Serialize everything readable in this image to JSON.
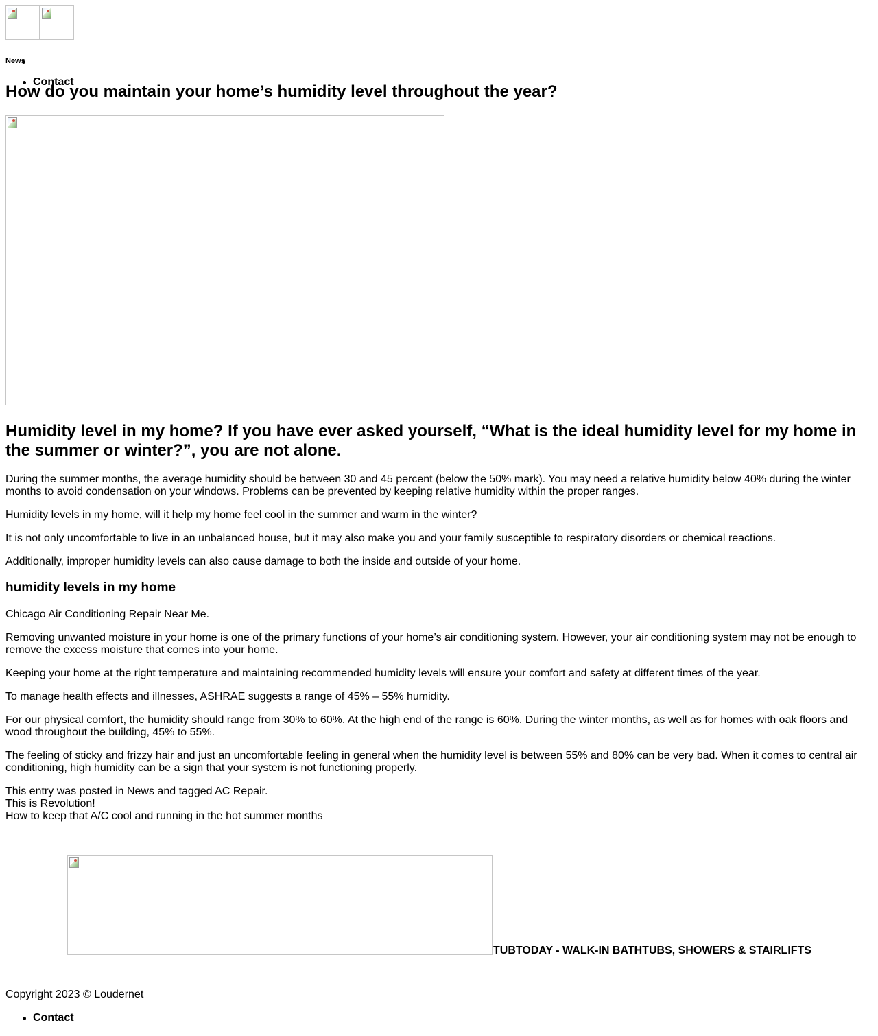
{
  "header": {
    "logo_images": [
      "logo-image-1",
      "logo-image-2"
    ],
    "nav": {
      "news_label": "News",
      "contact_label": "Contact"
    }
  },
  "article": {
    "title": "How do you maintain your home’s humidity level throughout the year?",
    "subtitle": "Humidity level in my home? If you have ever asked yourself, “What is the ideal humidity level for my home in the summer or winter?”, you are not alone.",
    "paragraphs_1": [
      "During the summer months, the average humidity should be between 30 and 45 percent (below the 50% mark). You may need a relative humidity below 40% during the winter months to avoid condensation on your windows. Problems can be prevented by keeping relative humidity within the proper ranges.",
      "Humidity levels in my home, will it help my home feel cool in the summer and warm in the winter?",
      "It is not only uncomfortable to live in an unbalanced house, but it may also make you and your family susceptible to respiratory disorders or chemical reactions.",
      "Additionally, improper humidity levels can also cause damage to both the inside and outside of your home."
    ],
    "section_heading": "humidity levels in my home",
    "paragraphs_2": [
      "Chicago Air Conditioning Repair Near Me.",
      "Removing unwanted moisture in your home is one of the primary functions of your home’s air conditioning system. However, your air conditioning system may not be enough to remove the excess moisture that comes into your home.",
      "Keeping your home at the right temperature and maintaining recommended humidity levels will ensure your comfort and safety at different times of the year.",
      "To manage health effects and illnesses, ASHRAE suggests a range of 45% – 55% humidity.",
      "For our physical comfort, the humidity should range from 30% to 60%. At the high end of the range is 60%. During the winter months, as well as for homes with oak floors and wood throughout the building, 45% to 55%.",
      "The feeling of sticky and frizzy hair and just an uncomfortable feeling in general when the humidity level is between 55% and 80% can be very bad. When it comes to central air conditioning, high humidity can be a sign that your system is not functioning properly."
    ],
    "meta": {
      "posted_prefix": "This entry was posted in ",
      "category": "News",
      "tagged_text": " and tagged ",
      "tag": "AC Repair",
      "end": "."
    },
    "post_nav": {
      "previous_prefix": "This is ",
      "previous_link": "Revolution",
      "previous_suffix": "!",
      "next_link": "How to keep that A/C cool and running in the hot summer months"
    }
  },
  "footer": {
    "brand_text": "TUBTODAY - WALK-IN BATHTUBS, SHOWERS & STAIRLIFTS",
    "copyright": "Copyright 2023 © Loudernet",
    "contact_label": "Contact"
  }
}
